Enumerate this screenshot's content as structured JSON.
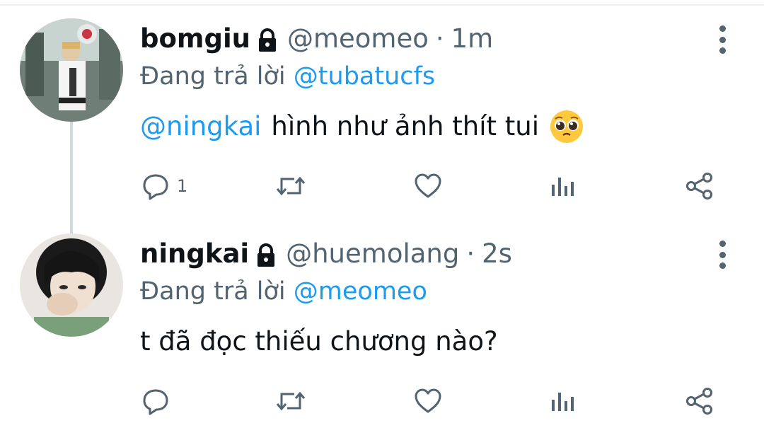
{
  "tweets": [
    {
      "display_name": "bomgiu",
      "handle": "@meomeo",
      "separator": "·",
      "time": "1m",
      "replying_prefix": "Đang trả lời",
      "replying_to": "@tubatucfs",
      "mention": "@ningkai",
      "text": "hình như ảnh thít tui",
      "emoji": "pleading-face",
      "reply_count": "1",
      "locked": true,
      "icons": [
        "lock-icon",
        "reply-icon",
        "retweet-icon",
        "like-icon",
        "analytics-icon",
        "share-icon",
        "more-icon"
      ]
    },
    {
      "display_name": "ningkai",
      "handle": "@huemolang",
      "separator": "·",
      "time": "2s",
      "replying_prefix": "Đang trả lời",
      "replying_to": "@meomeo",
      "mention": "",
      "text": "t đã đọc thiếu chương nào?",
      "reply_count": "",
      "locked": true,
      "icons": [
        "lock-icon",
        "reply-icon",
        "retweet-icon",
        "like-icon",
        "analytics-icon",
        "share-icon",
        "more-icon"
      ]
    }
  ],
  "colors": {
    "text": "#0f1419",
    "secondary": "#536471",
    "link": "#1d9bf0",
    "thread_line": "#cfd9de"
  }
}
